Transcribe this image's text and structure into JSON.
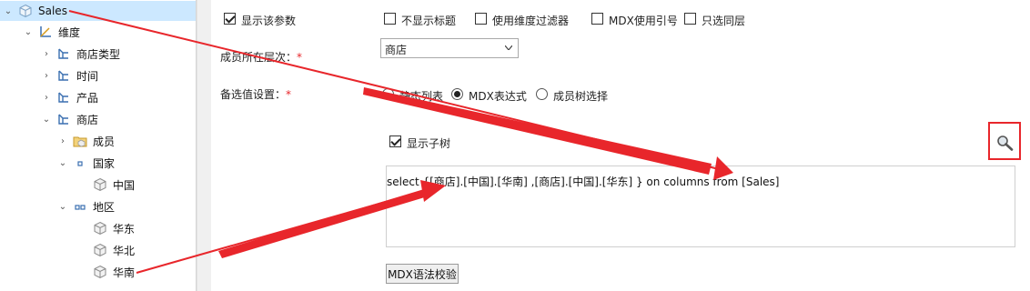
{
  "tree": {
    "root": "Sales",
    "dimension": "维度",
    "items": [
      {
        "label": "商店类型"
      },
      {
        "label": "时间"
      },
      {
        "label": "产品"
      },
      {
        "label": "商店"
      },
      {
        "label": "成员"
      },
      {
        "label": "国家"
      },
      {
        "label": "中国"
      },
      {
        "label": "地区"
      },
      {
        "label": "华东"
      },
      {
        "label": "华北"
      },
      {
        "label": "华南"
      }
    ]
  },
  "form": {
    "show_param": "显示该参数",
    "hide_title": "不显示标题",
    "use_dim_filter": "使用维度过滤器",
    "mdx_quote": "MDX使用引号",
    "same_level": "只选同层",
    "member_level_label": "成员所在层次：",
    "required_mark": "*",
    "level_value": "商店",
    "options_label": "备选值设置：",
    "radio_static": "静态列表",
    "radio_mdx": "MDX表达式",
    "radio_tree": "成员树选择",
    "show_subtree": "显示子树",
    "mdx_expression": "select {[商店].[中国].[华南] ,[商店].[中国].[华东] } on columns from [Sales]",
    "validate_button": "MDX语法校验"
  },
  "colors": {
    "accent": "#e8262b",
    "selection": "#cce8ff"
  }
}
